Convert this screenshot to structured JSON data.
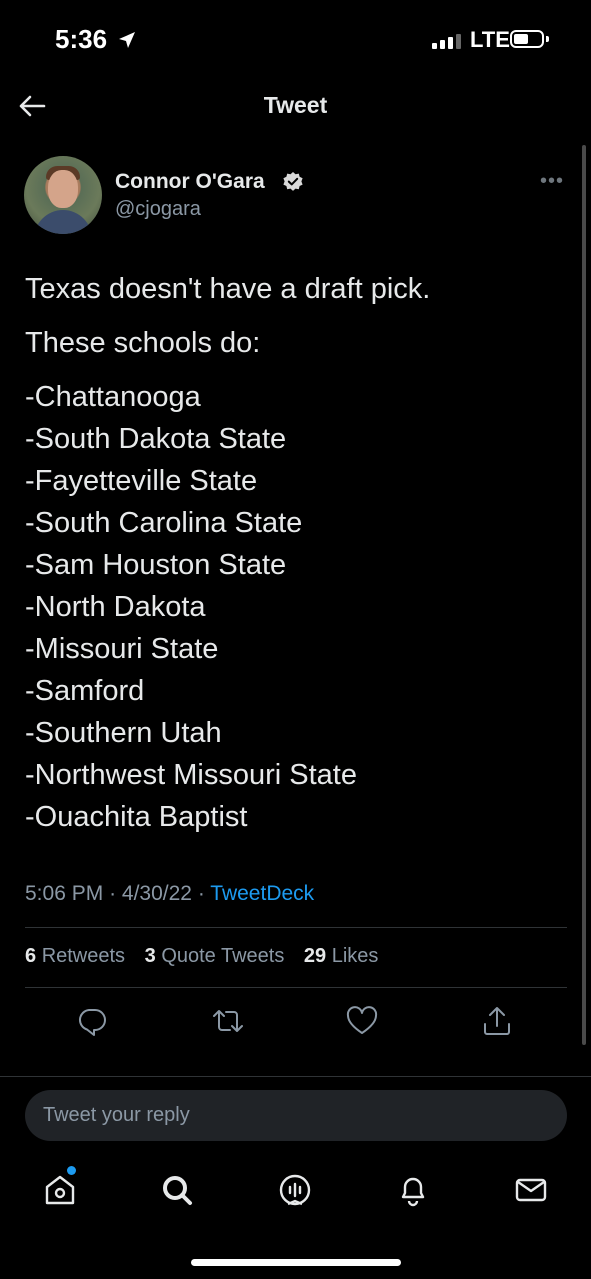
{
  "status_bar": {
    "time": "5:36",
    "network": "LTE"
  },
  "header": {
    "title": "Tweet"
  },
  "tweet": {
    "author_name": "Connor O'Gara",
    "handle": "@cjogara",
    "lines": [
      "Texas doesn't have a draft pick.",
      "These schools do:",
      "-Chattanooga",
      "-South Dakota State",
      "-Fayetteville State",
      "-South Carolina State",
      "-Sam Houston State",
      "-North Dakota",
      "-Missouri State",
      "-Samford",
      "-Southern Utah",
      "-Northwest Missouri State",
      "-Ouachita Baptist"
    ],
    "time": "5:06 PM",
    "date": "4/30/22",
    "separator": "·",
    "source": "TweetDeck"
  },
  "stats": {
    "retweets_count": "6",
    "retweets_label": "Retweets",
    "quotes_count": "3",
    "quotes_label": "Quote Tweets",
    "likes_count": "29",
    "likes_label": "Likes"
  },
  "reply": {
    "placeholder": "Tweet your reply"
  },
  "icons": {
    "back": "arrow-left-icon",
    "verified": "verified-badge-icon",
    "more": "more-icon",
    "reply": "reply-icon",
    "retweet": "retweet-icon",
    "like": "heart-icon",
    "share": "share-icon",
    "home": "home-icon",
    "search": "search-icon",
    "spaces": "spaces-icon",
    "notifications": "bell-icon",
    "messages": "mail-icon"
  },
  "colors": {
    "accent": "#1d9bf0",
    "background": "#000000",
    "secondary_text": "#8b98a5"
  }
}
